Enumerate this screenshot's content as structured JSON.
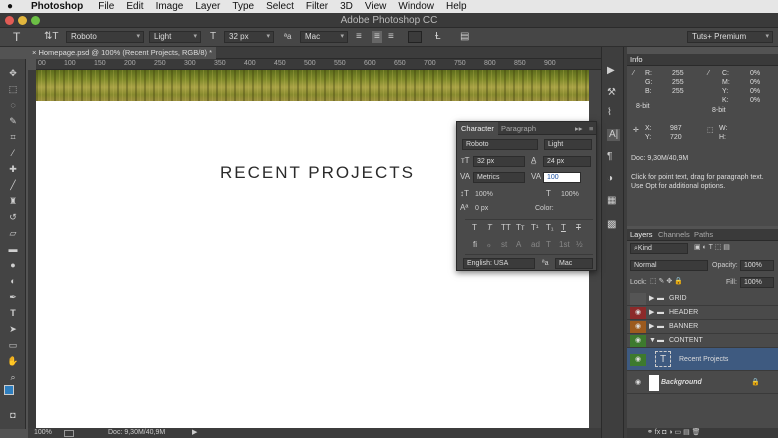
{
  "menubar": {
    "app": "Photoshop",
    "items": [
      "File",
      "Edit",
      "Image",
      "Layer",
      "Type",
      "Select",
      "Filter",
      "3D",
      "View",
      "Window",
      "Help"
    ]
  },
  "window": {
    "title": "Adobe Photoshop CC"
  },
  "options": {
    "font_family": "Roboto",
    "font_style": "Light",
    "font_size": "32 px",
    "aa_label": "ªa",
    "aa_value": "Mac",
    "workspace": "Tuts+ Premium"
  },
  "document": {
    "tab": "Homepage.psd @ 100% (Recent Projects, RGB/8) *",
    "ruler_labels": [
      "00",
      "100",
      "150",
      "200",
      "250",
      "300",
      "350",
      "400",
      "450",
      "500",
      "550",
      "600",
      "650",
      "700",
      "750",
      "800",
      "850",
      "900"
    ],
    "heading": "RECENT PROJECTS",
    "status_zoom": "100%",
    "status_doc": "Doc: 9,30M/40,9M"
  },
  "character": {
    "tabs": [
      "Character",
      "Paragraph"
    ],
    "font_family": "Roboto",
    "font_style": "Light",
    "size": "32 px",
    "leading": "24 px",
    "kerning": "Metrics",
    "tracking": "100",
    "vscale": "100%",
    "hscale": "100%",
    "baseline": "0 px",
    "color_label": "Color:",
    "language": "English: USA",
    "aa_label": "ªa",
    "aa_value": "Mac",
    "style_buttons": [
      "T",
      "T",
      "TT",
      "Tт",
      "T¹",
      "T₁",
      "T",
      "T"
    ],
    "ot_buttons": [
      "fi",
      "ℴ",
      "st",
      "A",
      "ad",
      "T",
      "1st",
      "½"
    ]
  },
  "info": {
    "tab": "Info",
    "r_label": "R:",
    "r": "255",
    "g_label": "G:",
    "g": "255",
    "b_label": "B:",
    "b": "255",
    "bit1": "8-bit",
    "c_label": "C:",
    "c": "0%",
    "m_label": "M:",
    "m": "0%",
    "y_label": "Y:",
    "y": "0%",
    "k_label": "K:",
    "k": "0%",
    "bit2": "8-bit",
    "x_label": "X:",
    "x": "987",
    "yy_label": "Y:",
    "yy": "720",
    "w_label": "W:",
    "h_label": "H:",
    "doc": "Doc: 9,30M/40,9M",
    "hint": "Click for point text, drag for paragraph text. Use Opt for additional options."
  },
  "layers": {
    "tabs": [
      "Layers",
      "Channels",
      "Paths"
    ],
    "filter": "Kind",
    "blend": "Normal",
    "opacity_label": "Opacity:",
    "opacity": "100%",
    "lock_label": "Lock:",
    "fill_label": "Fill:",
    "fill": "100%",
    "items": [
      {
        "name": "GRID",
        "type": "group",
        "eye": false,
        "color": "#555555"
      },
      {
        "name": "HEADER",
        "type": "group",
        "eye": true,
        "color": "#8c2a2a"
      },
      {
        "name": "BANNER",
        "type": "group",
        "eye": true,
        "color": "#9c5a1e"
      },
      {
        "name": "CONTENT",
        "type": "group-open",
        "eye": true,
        "color": "#3d7a2e"
      },
      {
        "name": "Recent Projects",
        "type": "text",
        "eye": true,
        "color": "#3d7a2e"
      },
      {
        "name": "Background",
        "type": "background",
        "eye": true,
        "color": ""
      }
    ]
  },
  "colors": {
    "accent": "#3e6fa8",
    "fg_swatch": "#2f7fbf",
    "bg_swatch": "#ffffff"
  }
}
